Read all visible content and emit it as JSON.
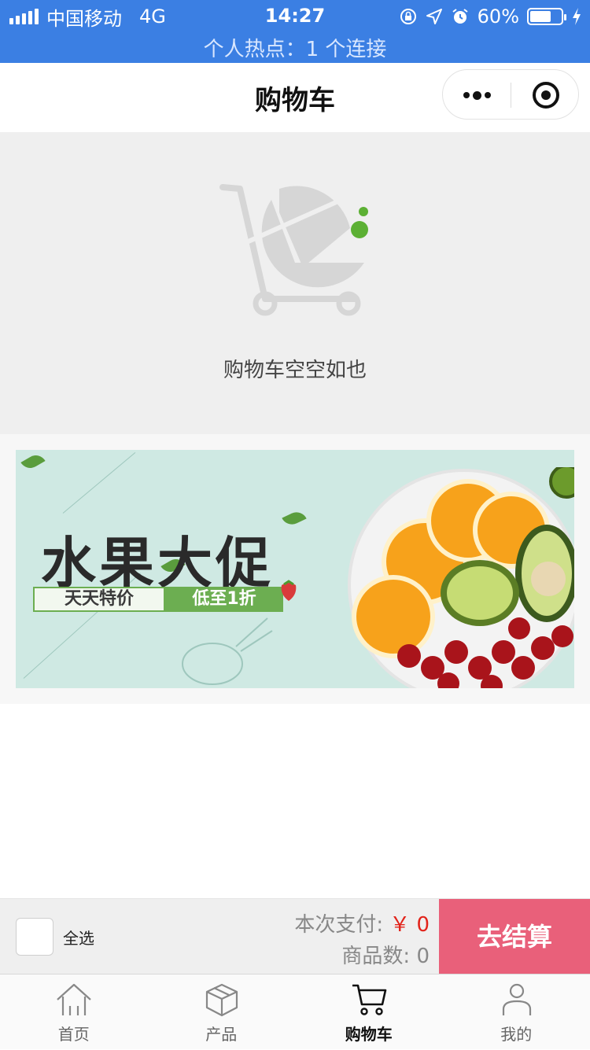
{
  "status_bar": {
    "carrier": "中国移动",
    "network": "4G",
    "time": "14:27",
    "battery": "60%",
    "battery_level": 0.6,
    "hotspot": "个人热点：1 个连接"
  },
  "navbar": {
    "title": "购物车"
  },
  "empty_cart": {
    "message": "购物车空空如也",
    "accent_color": "#5cb034"
  },
  "banner": {
    "headline": "水果大促",
    "tag_left": "天天特价",
    "tag_right": "低至1折"
  },
  "checkout": {
    "select_all_label": "全选",
    "pay_label": "本次支付:",
    "pay_amount": "￥ 0",
    "count_label": "商品数:",
    "count_value": "0",
    "checkout_button": "去结算",
    "checkout_color": "#e9607a"
  },
  "tabbar": {
    "items": [
      {
        "label": "首页",
        "icon": "home-icon",
        "active": false
      },
      {
        "label": "产品",
        "icon": "box-icon",
        "active": false
      },
      {
        "label": "购物车",
        "icon": "cart-icon",
        "active": true
      },
      {
        "label": "我的",
        "icon": "user-icon",
        "active": false
      }
    ]
  }
}
